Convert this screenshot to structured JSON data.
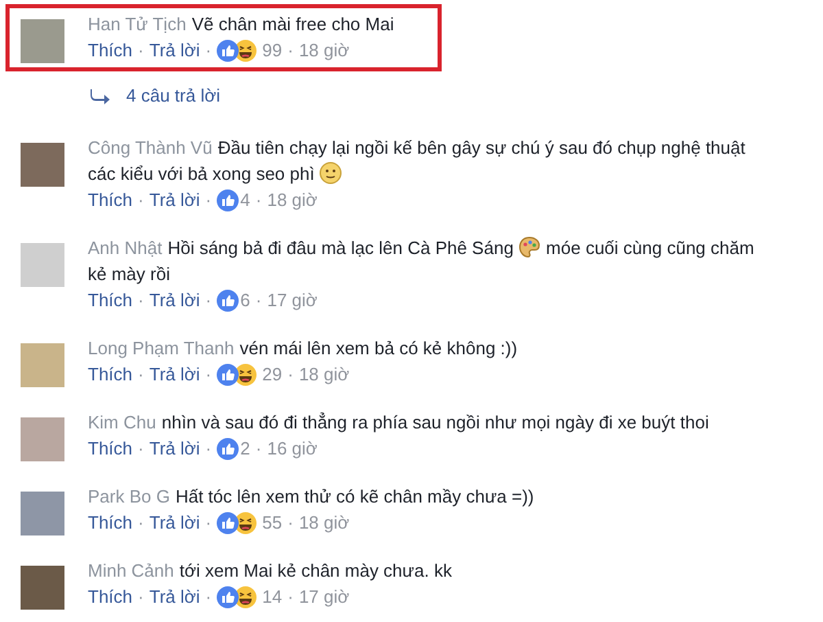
{
  "separator": "·",
  "comments": [
    {
      "name": "Han Tử Tịch",
      "highlighted": true,
      "parts": [
        {
          "kind": "text",
          "text": "Vẽ chân mài free cho Mai"
        }
      ],
      "actions": [
        "Thích",
        "Trả lời"
      ],
      "reactions": [
        {
          "kind": "like"
        },
        {
          "kind": "haha"
        }
      ],
      "count": "99",
      "time": "18 giờ",
      "replies": "4 câu trả lời"
    },
    {
      "name": "Công Thành Vũ",
      "highlighted": false,
      "parts": [
        {
          "kind": "text",
          "text": "Đầu tiên chạy lại ngồi kế bên gây sự chú ý sau đó chụp nghệ thuật các kiểu với bả xong seo phì"
        },
        {
          "kind": "emoji"
        }
      ],
      "actions": [
        "Thích",
        "Trả lời"
      ],
      "reactions": [
        {
          "kind": "like"
        }
      ],
      "count": "4",
      "time": "18 giờ"
    },
    {
      "name": "Anh Nhật",
      "highlighted": false,
      "parts": [
        {
          "kind": "text",
          "text": "Hồi sáng bả đi đâu mà lạc lên Cà Phê Sáng"
        },
        {
          "kind": "palette"
        },
        {
          "kind": "text",
          "text": "móe cuối cùng cũng chăm kẻ mày rồi"
        }
      ],
      "actions": [
        "Thích",
        "Trả lời"
      ],
      "reactions": [
        {
          "kind": "like"
        }
      ],
      "count": "6",
      "time": "17 giờ"
    },
    {
      "name": "Long Phạm Thanh",
      "highlighted": false,
      "parts": [
        {
          "kind": "text",
          "text": "vén mái lên xem bả có kẻ không :))"
        }
      ],
      "actions": [
        "Thích",
        "Trả lời"
      ],
      "reactions": [
        {
          "kind": "like"
        },
        {
          "kind": "haha"
        }
      ],
      "count": "29",
      "time": "18 giờ"
    },
    {
      "name": "Kim Chu",
      "highlighted": false,
      "parts": [
        {
          "kind": "text",
          "text": "nhìn và sau đó đi thẳng ra phía sau ngồi như mọi ngày đi xe buýt thoi"
        }
      ],
      "actions": [
        "Thích",
        "Trả lời"
      ],
      "reactions": [
        {
          "kind": "like"
        }
      ],
      "count": "2",
      "time": "16 giờ"
    },
    {
      "name": "Park Bo G",
      "highlighted": false,
      "parts": [
        {
          "kind": "text",
          "text": "Hất tóc lên xem thử có kẽ chân mầy chưa =))"
        }
      ],
      "actions": [
        "Thích",
        "Trả lời"
      ],
      "reactions": [
        {
          "kind": "like"
        },
        {
          "kind": "haha"
        }
      ],
      "count": "55",
      "time": "18 giờ"
    },
    {
      "name": "Minh Cảnh",
      "highlighted": false,
      "parts": [
        {
          "kind": "text",
          "text": "tới xem Mai kẻ chân mày chưa. kk"
        }
      ],
      "actions": [
        "Thích",
        "Trả lời"
      ],
      "reactions": [
        {
          "kind": "like"
        },
        {
          "kind": "haha"
        }
      ],
      "count": "14",
      "time": "17 giờ"
    }
  ]
}
